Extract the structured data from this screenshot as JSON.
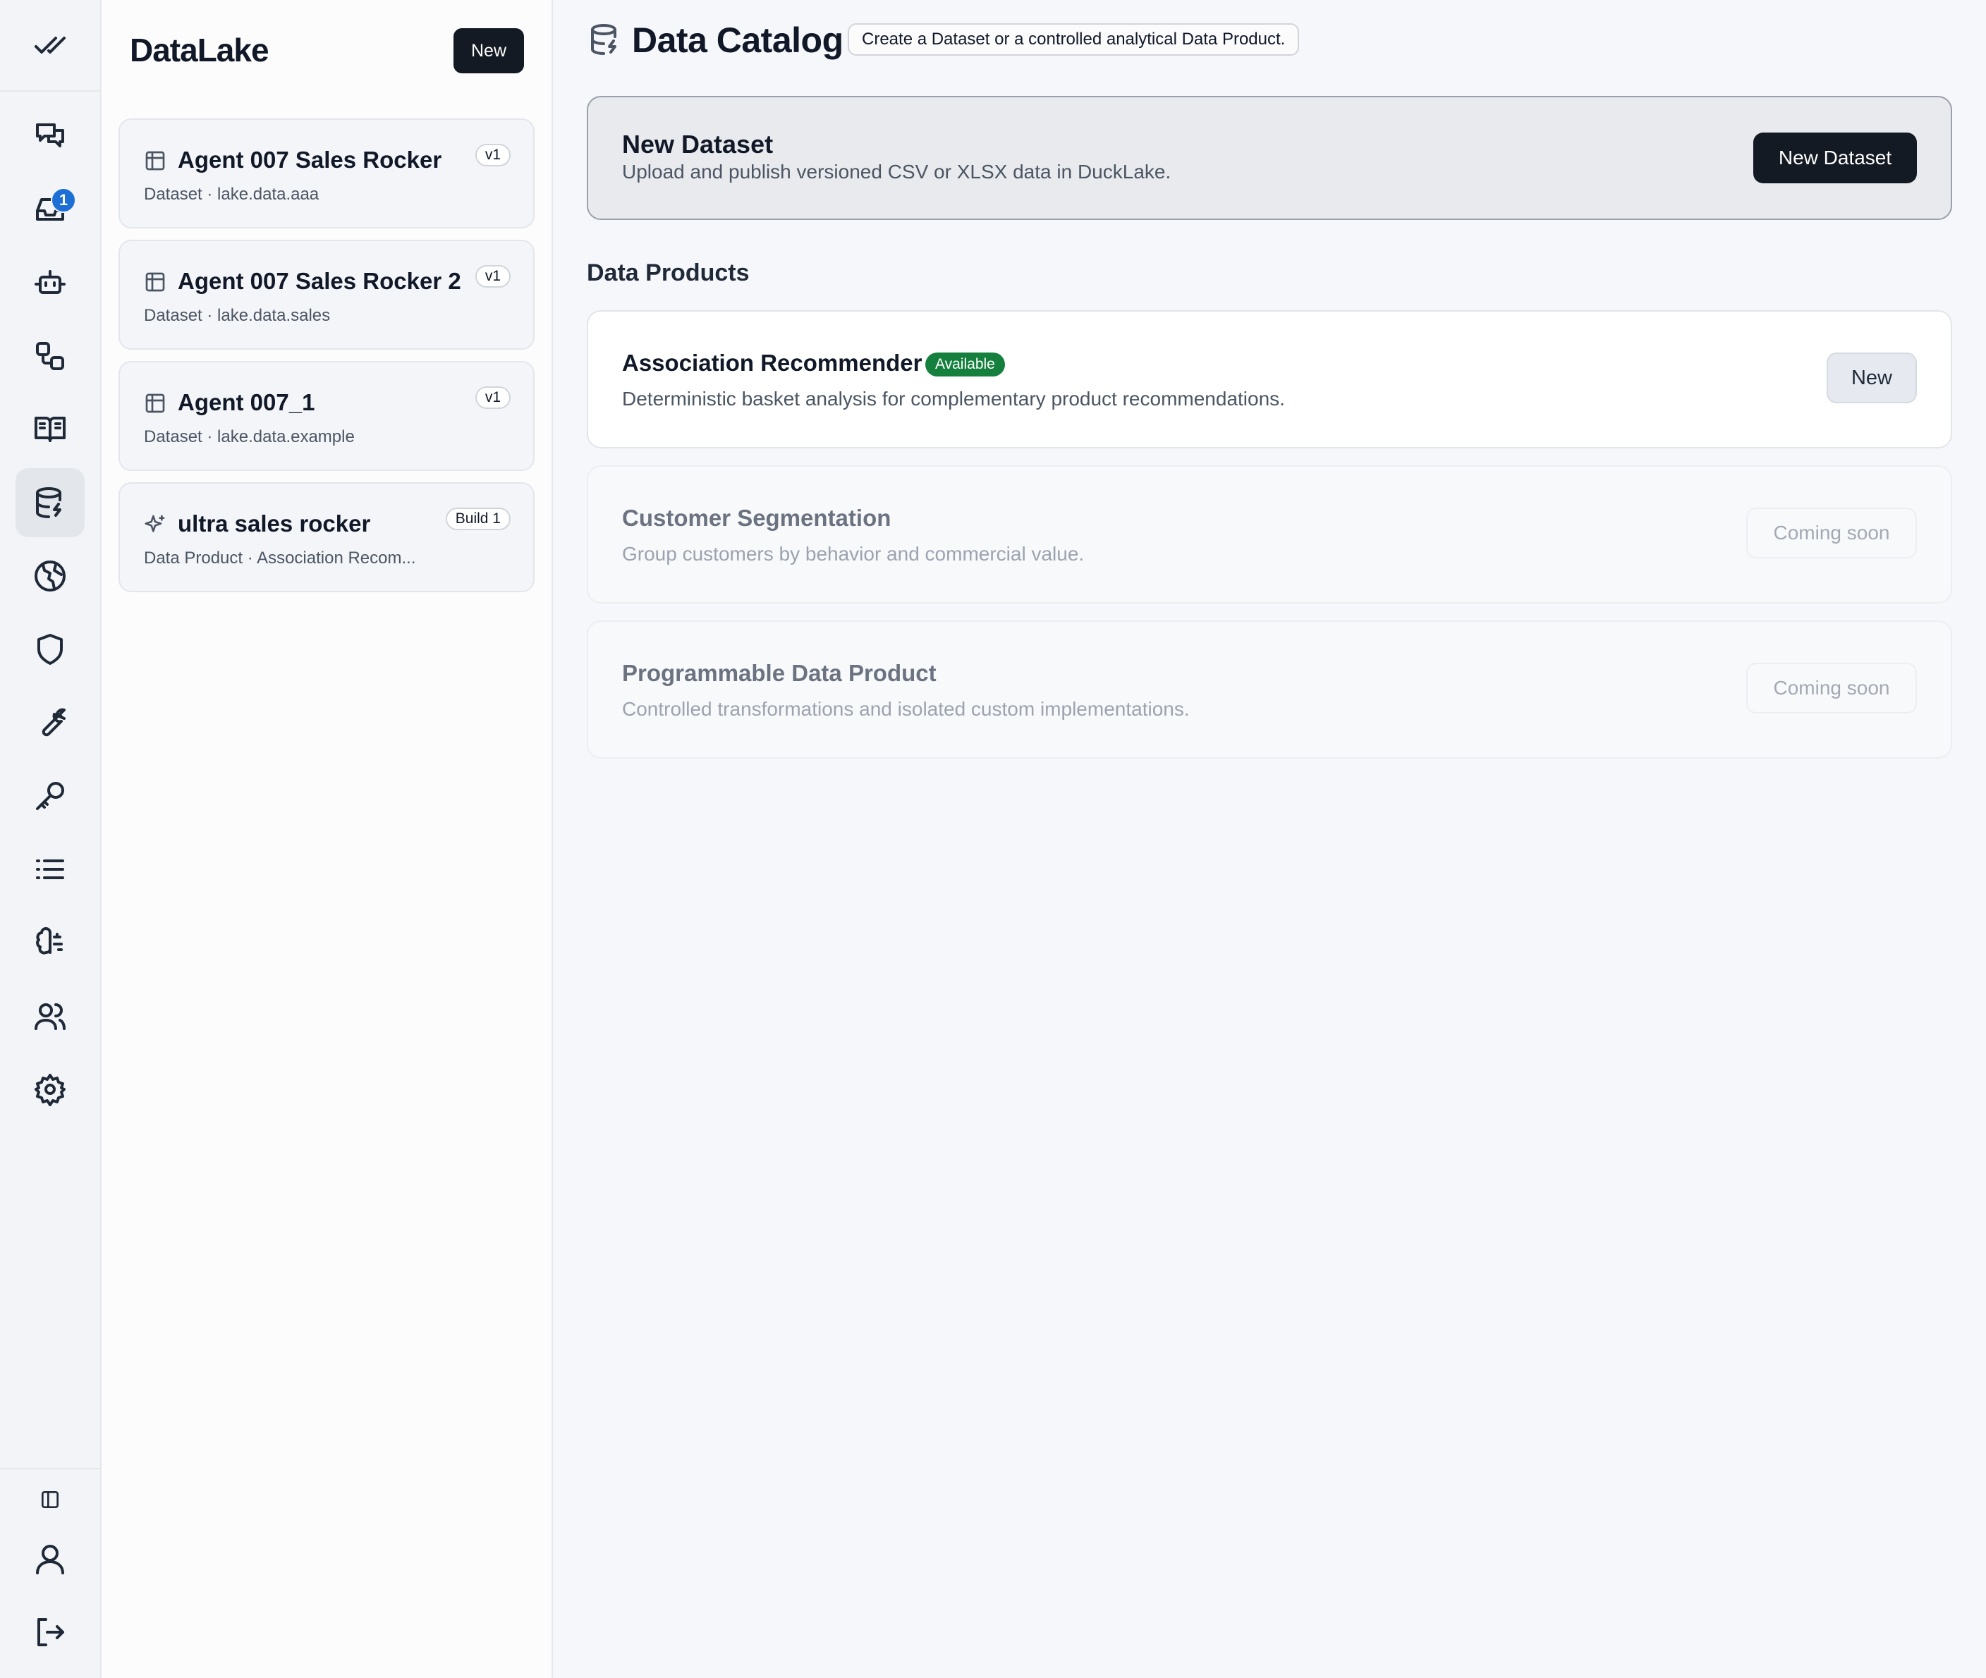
{
  "rail": {
    "items": [
      {
        "icon": "chat-icon"
      },
      {
        "icon": "inbox-icon",
        "badge": "1"
      },
      {
        "icon": "bot-icon"
      },
      {
        "icon": "workflow-icon"
      },
      {
        "icon": "book-icon"
      },
      {
        "icon": "database-icon",
        "active": true
      },
      {
        "icon": "globe-icon"
      },
      {
        "icon": "shield-icon"
      },
      {
        "icon": "wrench-icon"
      },
      {
        "icon": "key-icon"
      },
      {
        "icon": "list-icon"
      },
      {
        "icon": "brain-icon"
      },
      {
        "icon": "users-icon"
      },
      {
        "icon": "settings-icon"
      }
    ],
    "bottom": [
      {
        "icon": "sidebar-toggle-icon"
      },
      {
        "icon": "user-icon"
      },
      {
        "icon": "logout-icon"
      }
    ]
  },
  "panel": {
    "title": "DataLake",
    "new_label": "New",
    "items": [
      {
        "title": "Agent 007 Sales Rocker",
        "subtitle": "Dataset · lake.data.aaa",
        "tag": "v1",
        "icon": "table-icon"
      },
      {
        "title": "Agent 007 Sales Rocker 2",
        "subtitle": "Dataset · lake.data.sales",
        "tag": "v1",
        "icon": "table-icon"
      },
      {
        "title": "Agent 007_1",
        "subtitle": "Dataset · lake.data.example",
        "tag": "v1",
        "icon": "table-icon"
      },
      {
        "title": "ultra sales rocker",
        "subtitle": "Data Product · Association Recom...",
        "tag": "Build 1",
        "icon": "sparkles-icon"
      }
    ]
  },
  "main": {
    "title": "Data Catalog",
    "subtitle_chip": "Create a Dataset or a controlled analytical Data Product.",
    "new_dataset": {
      "title": "New Dataset",
      "description": "Upload and publish versioned CSV or XLSX data in DuckLake.",
      "button": "New Dataset"
    },
    "products_heading": "Data Products",
    "products": [
      {
        "title": "Association Recommender",
        "status": "Available",
        "description": "Deterministic basket analysis for complementary product recommendations.",
        "button": "New"
      },
      {
        "title": "Customer Segmentation",
        "description": "Group customers by behavior and commercial value.",
        "button": "Coming soon"
      },
      {
        "title": "Programmable Data Product",
        "description": "Controlled transformations and isolated custom implementations.",
        "button": "Coming soon"
      }
    ]
  }
}
